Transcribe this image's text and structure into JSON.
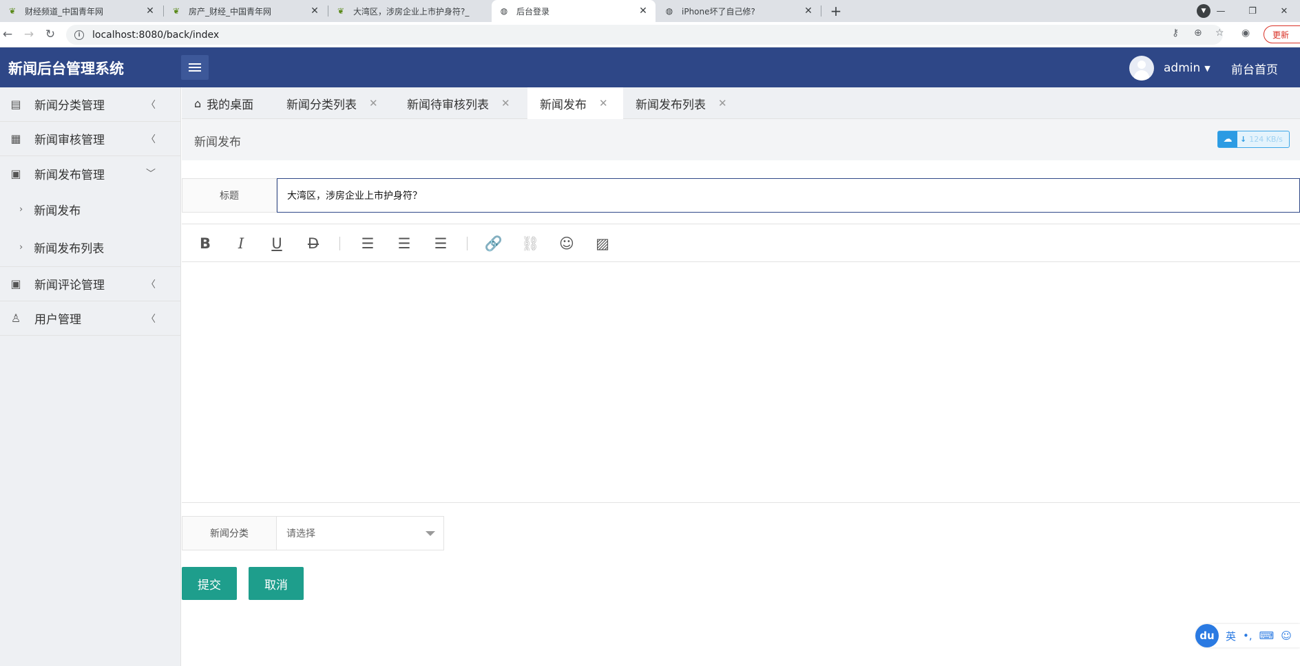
{
  "browser": {
    "tabs": [
      {
        "title": "财经频道_中国青年网",
        "icon": "leaf-icon",
        "active": false
      },
      {
        "title": "房产_财经_中国青年网",
        "icon": "leaf-icon",
        "active": false
      },
      {
        "title": "大湾区，涉房企业上市护身符?_",
        "icon": "leaf-icon",
        "active": false
      },
      {
        "title": "后台登录",
        "icon": "globe-icon",
        "active": true
      },
      {
        "title": "iPhone坏了自己修?",
        "icon": "globe-icon",
        "active": false
      }
    ],
    "url": "localhost:8080/back/index",
    "update_label": "更新"
  },
  "header": {
    "logo": "新闻后台管理系统",
    "username": "admin",
    "front_link": "前台首页"
  },
  "sidebar": {
    "items": [
      {
        "label": "新闻分类管理",
        "icon": "document-icon",
        "expanded": false
      },
      {
        "label": "新闻审核管理",
        "icon": "table-icon",
        "expanded": false
      },
      {
        "label": "新闻发布管理",
        "icon": "publish-icon",
        "expanded": true,
        "children": [
          {
            "label": "新闻发布"
          },
          {
            "label": "新闻发布列表"
          }
        ]
      },
      {
        "label": "新闻评论管理",
        "icon": "comment-icon",
        "expanded": false
      },
      {
        "label": "用户管理",
        "icon": "user-icon",
        "expanded": false
      }
    ]
  },
  "content_tabs": [
    {
      "label": "我的桌面",
      "closable": false
    },
    {
      "label": "新闻分类列表",
      "closable": true
    },
    {
      "label": "新闻待审核列表",
      "closable": true
    },
    {
      "label": "新闻发布",
      "closable": true,
      "active": true
    },
    {
      "label": "新闻发布列表",
      "closable": true
    }
  ],
  "page": {
    "title": "新闻发布",
    "speed_label": "124 KB/s"
  },
  "form": {
    "title_label": "标题",
    "title_value": "大湾区，涉房企业上市护身符？",
    "category_label": "新闻分类",
    "category_placeholder": "请选择",
    "submit_label": "提交",
    "cancel_label": "取消"
  },
  "editor": {
    "toolbar": [
      "bold-icon",
      "italic-icon",
      "underline-icon",
      "strikethrough-icon",
      "align-left-icon",
      "align-center-icon",
      "align-right-icon",
      "link-icon",
      "unlink-icon",
      "emoji-icon",
      "image-icon"
    ]
  },
  "ime": {
    "logo": "du",
    "mode": "英"
  },
  "colors": {
    "header_bg": "#2e4787",
    "button_bg": "#1e9e8c",
    "sidebar_bg": "#eef0f3"
  }
}
